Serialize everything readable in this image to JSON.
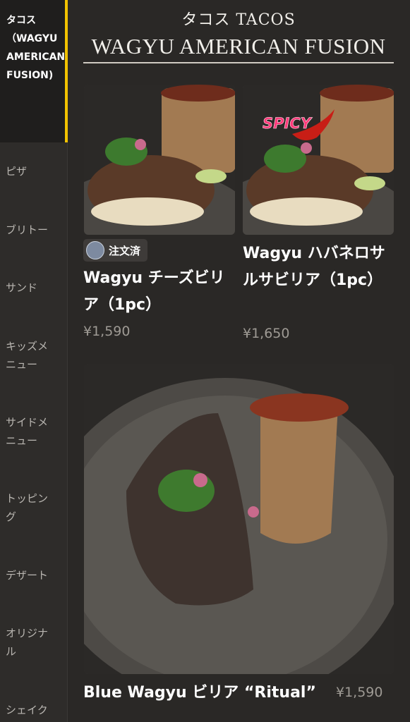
{
  "sidebar": {
    "items": [
      {
        "label": "タコス（WAGYU AMERICAN FUSION)",
        "active": true
      },
      {
        "label": "ピザ"
      },
      {
        "label": "ブリトー"
      },
      {
        "label": "サンド"
      },
      {
        "label": "キッズメニュー"
      },
      {
        "label": "サイドメニュー"
      },
      {
        "label": "トッピング"
      },
      {
        "label": "デザート"
      },
      {
        "label": "オリジナル"
      },
      {
        "label": "シェイク"
      }
    ]
  },
  "header": {
    "title_jp": "タコス TACOS",
    "title_en": "WAGYU AMERICAN FUSION"
  },
  "products": [
    {
      "name": "Wagyu チーズビリア（1pc）",
      "price": "¥1,590",
      "badge": "注文済"
    },
    {
      "name": "Wagyu ハバネロサルサビリア（1pc）",
      "price": "¥1,650",
      "overlay_text": "SPICY"
    },
    {
      "name": "Blue Wagyu ビリア “Ritual”",
      "price": "¥1,590"
    }
  ],
  "colors": {
    "background": "#2a2826",
    "sidebar_bg": "#2e2c2a",
    "active_bg": "#1f1e1d",
    "accent": "#f2c200",
    "price": "#9e9a94"
  }
}
